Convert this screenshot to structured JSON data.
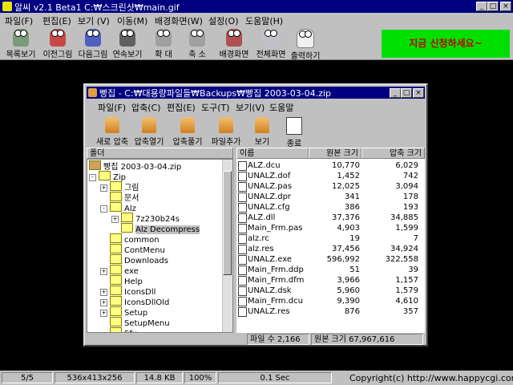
{
  "window": {
    "title": "알씨 v2.1 Beta1 C:₩스크린샷₩main.gif",
    "controls": [
      "_",
      "□",
      "×"
    ]
  },
  "menu": [
    "파일(F)",
    "편집(E)",
    "보기 (V)",
    "이동(M)",
    "배경화면(W)",
    "설정(O)",
    "도움말(H)"
  ],
  "toolbar": [
    "목록보기",
    "이전그림",
    "다음그림",
    "연속보기",
    "확 대",
    "축 소",
    "배경화면",
    "전체화면",
    "출력하기"
  ],
  "banner": "지금 신청하세요~",
  "statusbar": {
    "cells": [
      "5/5",
      "536x413x256",
      "14.8 KB",
      "100%",
      "0.1 Sec"
    ],
    "copyright": "Copyright(c) http://www.happycgi.com"
  },
  "inner": {
    "title": "빵집 - C:₩대용량파일들₩Backups₩빵집 2003-03-04.zip",
    "controls": [
      "_",
      "□",
      "×"
    ],
    "menu": [
      "파일(F)",
      "압축(C)",
      "편집(E)",
      "도구(T)",
      "보기(V)",
      "도움말"
    ],
    "toolbar": [
      "새로 압축",
      "압축열기",
      "압축풀기",
      "파일추가",
      "보기",
      "종료"
    ],
    "folder_header": "폴더",
    "tree": [
      {
        "label": "빵집 2003-03-04.zip",
        "depth": 0,
        "exp": "",
        "icon": "zip"
      },
      {
        "label": "Zip",
        "depth": 0,
        "exp": "-",
        "icon": "folder"
      },
      {
        "label": "그림",
        "depth": 1,
        "exp": "+",
        "icon": "folder"
      },
      {
        "label": "문서",
        "depth": 1,
        "exp": "",
        "icon": "folder"
      },
      {
        "label": "Alz",
        "depth": 1,
        "exp": "-",
        "icon": "folder"
      },
      {
        "label": "7z230b24s",
        "depth": 2,
        "exp": "+",
        "icon": "folder"
      },
      {
        "label": "Alz Decompress",
        "depth": 2,
        "exp": "",
        "icon": "folder",
        "selected": true
      },
      {
        "label": "common",
        "depth": 1,
        "exp": "",
        "icon": "folder"
      },
      {
        "label": "ContMenu",
        "depth": 1,
        "exp": "",
        "icon": "folder"
      },
      {
        "label": "Downloads",
        "depth": 1,
        "exp": "",
        "icon": "folder"
      },
      {
        "label": "exe",
        "depth": 1,
        "exp": "+",
        "icon": "folder"
      },
      {
        "label": "Help",
        "depth": 1,
        "exp": "",
        "icon": "folder"
      },
      {
        "label": "IconsDll",
        "depth": 1,
        "exp": "+",
        "icon": "folder"
      },
      {
        "label": "IconsDllOld",
        "depth": 1,
        "exp": "+",
        "icon": "folder"
      },
      {
        "label": "Setup",
        "depth": 1,
        "exp": "+",
        "icon": "folder"
      },
      {
        "label": "SetupMenu",
        "depth": 1,
        "exp": "",
        "icon": "folder"
      },
      {
        "label": "Sfx",
        "depth": 1,
        "exp": "",
        "icon": "folder"
      }
    ],
    "file_columns": [
      "이름",
      "원본 크기",
      "압축 크기"
    ],
    "files": [
      {
        "name": "ALZ.dcu",
        "orig": "10,770",
        "comp": "6,029"
      },
      {
        "name": "UNALZ.dof",
        "orig": "1,452",
        "comp": "742"
      },
      {
        "name": "UNALZ.pas",
        "orig": "12,025",
        "comp": "3,094"
      },
      {
        "name": "UNALZ.dpr",
        "orig": "341",
        "comp": "178"
      },
      {
        "name": "UNALZ.cfg",
        "orig": "386",
        "comp": "193"
      },
      {
        "name": "ALZ.dll",
        "orig": "37,376",
        "comp": "34,885"
      },
      {
        "name": "Main_Frm.pas",
        "orig": "4,903",
        "comp": "1,599"
      },
      {
        "name": "alz.rc",
        "orig": "19",
        "comp": "7"
      },
      {
        "name": "alz.res",
        "orig": "37,456",
        "comp": "34,924"
      },
      {
        "name": "UNALZ.exe",
        "orig": "596,992",
        "comp": "322,558"
      },
      {
        "name": "Main_Frm.ddp",
        "orig": "51",
        "comp": "39"
      },
      {
        "name": "Main_Frm.dfm",
        "orig": "3,966",
        "comp": "1,157"
      },
      {
        "name": "UNALZ.dsk",
        "orig": "5,960",
        "comp": "1,579"
      },
      {
        "name": "Main_Frm.dcu",
        "orig": "9,390",
        "comp": "4,610"
      },
      {
        "name": "UNALZ.res",
        "orig": "876",
        "comp": "357"
      }
    ],
    "status": {
      "file_count": "파일 수 2,166",
      "orig_size": "원본 크기 67,967,616"
    }
  }
}
